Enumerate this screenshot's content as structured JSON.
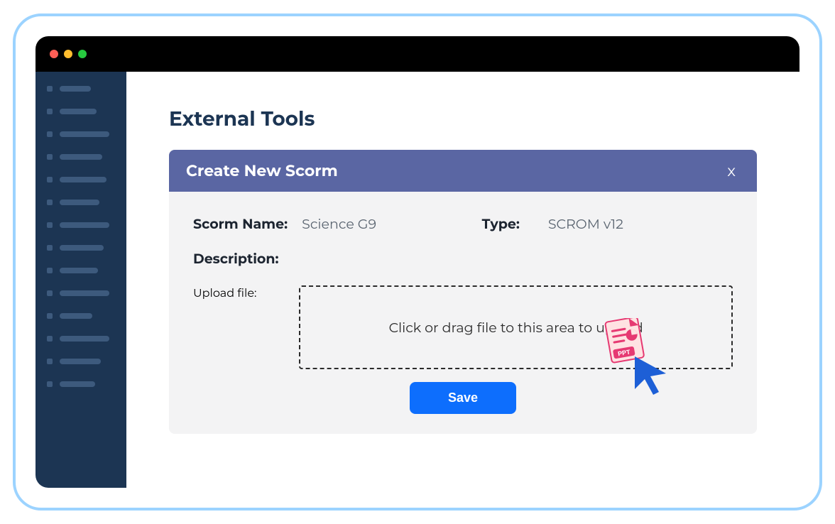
{
  "page": {
    "title": "External Tools"
  },
  "modal": {
    "title": "Create New Scorm",
    "close": "x",
    "fields": {
      "name_label": "Scorm Name:",
      "name_value": "Science G9",
      "type_label": "Type:",
      "type_value": "SCROM v12",
      "description_label": "Description:",
      "upload_label": "Upload file:"
    },
    "dropzone_text": "Click or drag file to this area to upload",
    "save_label": "Save",
    "drag_file_badge": "PPT"
  },
  "colors": {
    "accent_blue": "#0d6efd",
    "modal_header": "#5a66a3",
    "sidebar": "#1c3553",
    "frame_border": "#9cd3ff"
  }
}
